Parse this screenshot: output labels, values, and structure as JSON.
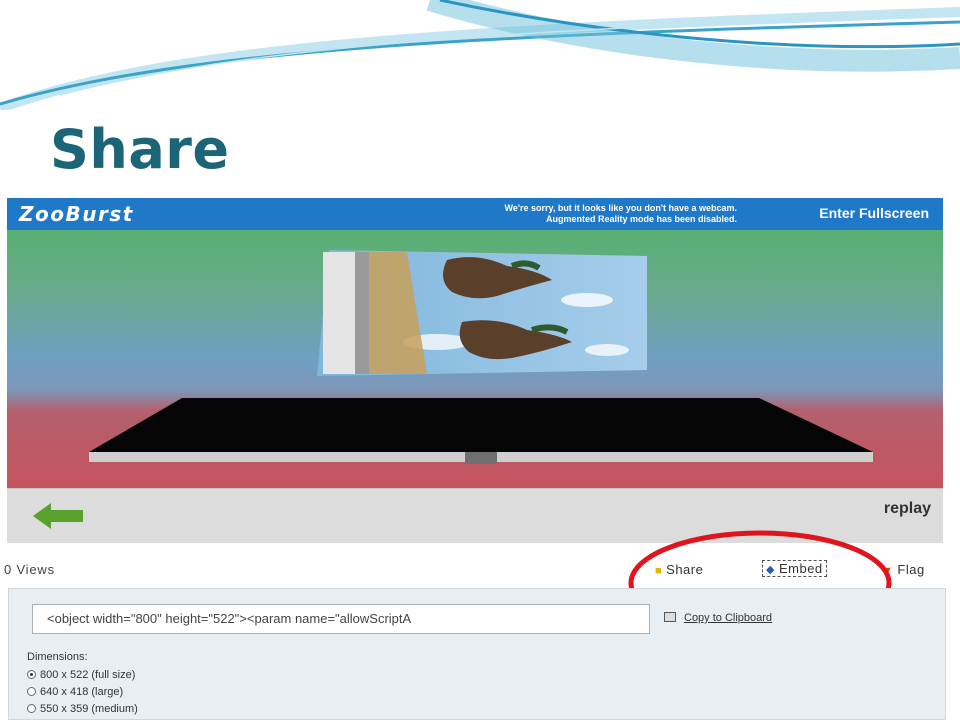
{
  "slide": {
    "title": "Share"
  },
  "player": {
    "logo": "ZooBurst",
    "webcam_message_line1": "We're sorry, but it looks like you don't have a webcam.",
    "webcam_message_line2": "Augmented Reality mode has been disabled.",
    "fullscreen_label": "Enter Fullscreen",
    "replay_label": "replay"
  },
  "share_bar": {
    "views": "0 Views",
    "share_label": "Share",
    "embed_label": "Embed",
    "flag_label": "Flag"
  },
  "embed_panel": {
    "code_value": "<object width=\"800\" height=\"522\"><param name=\"allowScriptA",
    "copy_label": "Copy to Clipboard",
    "dimensions_label": "Dimensions:",
    "options": [
      {
        "label": "800 x 522 (full size)",
        "selected": true
      },
      {
        "label": "640 x 418 (large)",
        "selected": false
      },
      {
        "label": "550 x 359 (medium)",
        "selected": false
      }
    ]
  },
  "colors": {
    "title": "#1c6477",
    "player_bar": "#1f78c8",
    "highlight_circle": "#e0141c"
  }
}
